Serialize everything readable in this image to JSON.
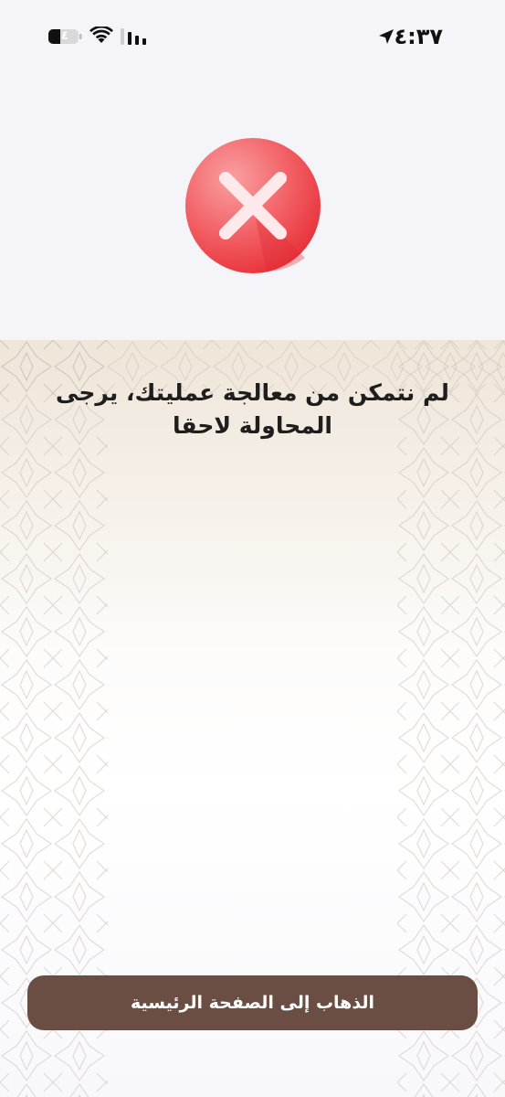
{
  "status_bar": {
    "time": "٤:٣٧",
    "battery_level": "٤",
    "icons": [
      "location-arrow-icon",
      "battery-icon",
      "wifi-icon",
      "cellular-signal-icon"
    ]
  },
  "error": {
    "icon": "close-x-icon",
    "color": "#f04a4f",
    "message": "لم نتمكن من معالجة عمليتك، يرجى المحاولة لاحقا"
  },
  "actions": {
    "home_button_label": "الذهاب إلى الصفحة الرئيسية",
    "home_button_color": "#6b4e43"
  }
}
